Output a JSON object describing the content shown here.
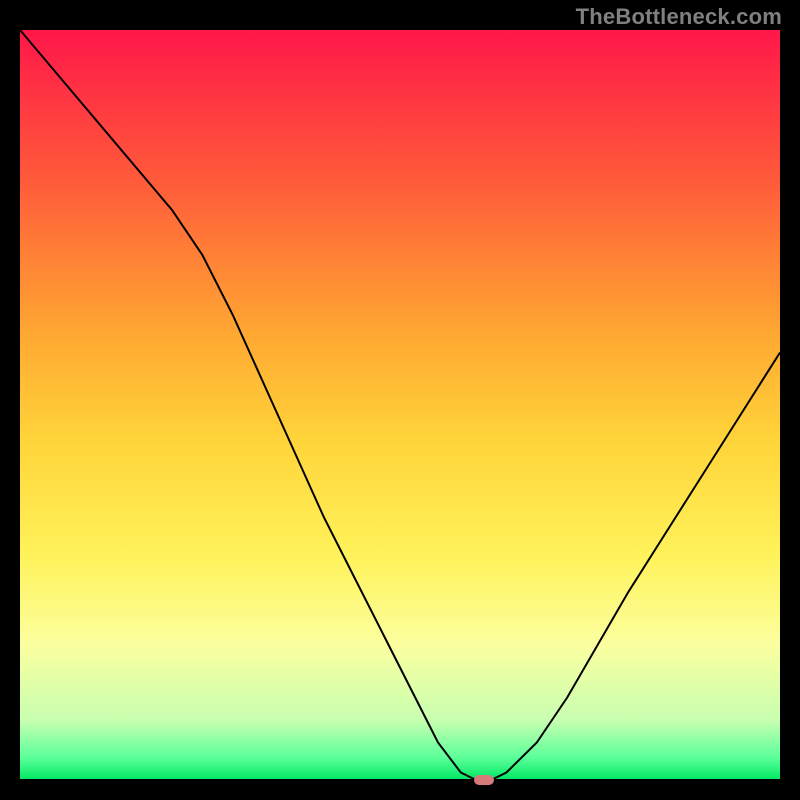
{
  "watermark": "TheBottleneck.com",
  "chart_data": {
    "type": "line",
    "title": "",
    "xlabel": "",
    "ylabel": "",
    "xlim": [
      0,
      100
    ],
    "ylim": [
      0,
      100
    ],
    "grid": false,
    "curve": {
      "x": [
        0,
        5,
        10,
        15,
        20,
        24,
        28,
        32,
        36,
        40,
        44,
        48,
        52,
        55,
        58,
        60,
        62,
        64,
        68,
        72,
        76,
        80,
        85,
        90,
        95,
        100
      ],
      "y": [
        100,
        94,
        88,
        82,
        76,
        70,
        62,
        53,
        44,
        35,
        27,
        19,
        11,
        5,
        1,
        0,
        0,
        1,
        5,
        11,
        18,
        25,
        33,
        41,
        49,
        57
      ]
    },
    "marker": {
      "x": 61,
      "y": 0,
      "color": "#d67a7a"
    },
    "gradient_stops": [
      {
        "offset": 0.0,
        "color": "#ff1749"
      },
      {
        "offset": 0.2,
        "color": "#ff5a3a"
      },
      {
        "offset": 0.4,
        "color": "#ffa632"
      },
      {
        "offset": 0.55,
        "color": "#ffd53a"
      },
      {
        "offset": 0.7,
        "color": "#fff25a"
      },
      {
        "offset": 0.82,
        "color": "#fbff9f"
      },
      {
        "offset": 0.92,
        "color": "#c8ffb0"
      },
      {
        "offset": 0.97,
        "color": "#5cff9a"
      },
      {
        "offset": 1.0,
        "color": "#00e862"
      }
    ],
    "baseline": {
      "visible": true,
      "y": 0,
      "color": "#000000",
      "width": 2
    }
  }
}
